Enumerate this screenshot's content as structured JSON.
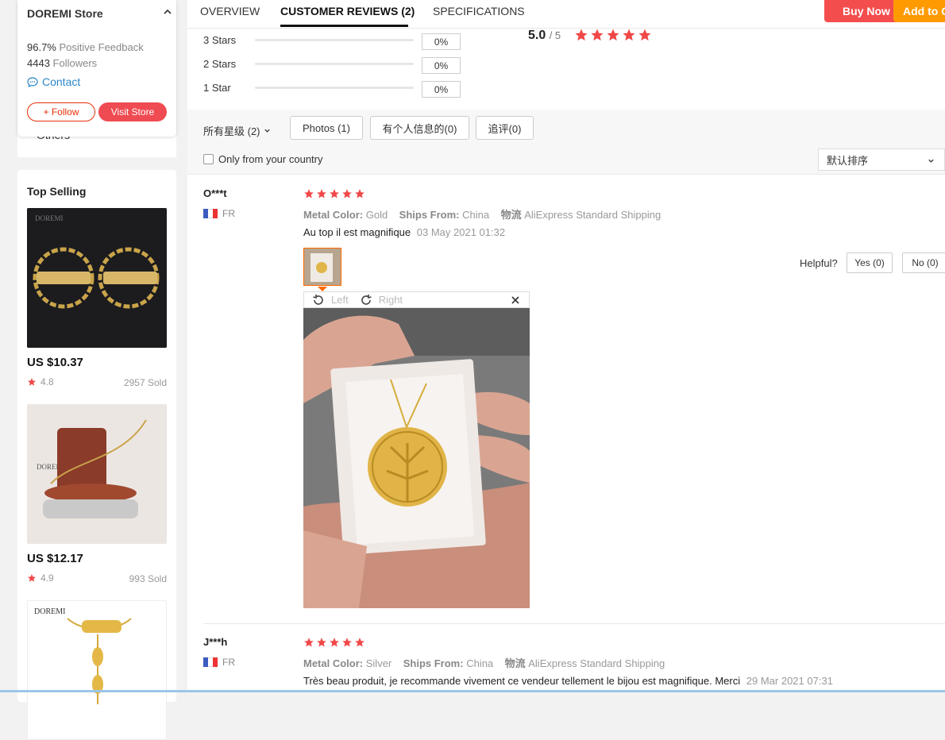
{
  "store": {
    "name": "DOREMI Store",
    "positive_value": "96.7%",
    "positive_label": "Positive Feedback",
    "followers_value": "4443",
    "followers_label": "Followers",
    "contact": "Contact",
    "follow": "+ Follow",
    "visit": "Visit Store",
    "others": "Others"
  },
  "top_selling": {
    "title": "Top Selling",
    "items": [
      {
        "price": "US $10.37",
        "rating": "4.8",
        "sold": "2957 Sold",
        "img_label": "DOREMI"
      },
      {
        "price": "US $12.17",
        "rating": "4.9",
        "sold": "993 Sold",
        "img_label": "DOREMI"
      },
      {
        "img_label": "DOREMI"
      }
    ]
  },
  "tabs": [
    {
      "label": "OVERVIEW"
    },
    {
      "label": "CUSTOMER REVIEWS (2)"
    },
    {
      "label": "SPECIFICATIONS"
    }
  ],
  "actions": {
    "buy_now": "Buy Now",
    "add_to_cart": "Add to C"
  },
  "rating_breakdown": [
    {
      "label": "3 Stars",
      "pct": "0%"
    },
    {
      "label": "2 Stars",
      "pct": "0%"
    },
    {
      "label": "1 Star",
      "pct": "0%"
    }
  ],
  "overall": {
    "score": "5.0",
    "out_of": "/ 5",
    "stars": 5
  },
  "filters": {
    "all_ratings": "所有星级 (2)",
    "photos": "Photos (1)",
    "personal_info": "有个人信息的(0)",
    "additional": "追评(0)",
    "only_country": "Only from your country",
    "sort": "默认排序"
  },
  "reviews": [
    {
      "user": "O***t",
      "country": "FR",
      "stars": 5,
      "color_label": "Metal Color:",
      "color": "Gold",
      "ships_label": "Ships From:",
      "ships": "China",
      "logistics_label": "物流",
      "logistics": "AliExpress Standard Shipping",
      "text": "Au top il est magnifique",
      "date": "03 May 2021 01:32",
      "helpful": "Helpful?",
      "yes": "Yes (0)",
      "no": "No (0)",
      "viewer_left": "Left",
      "viewer_right": "Right"
    },
    {
      "user": "J***h",
      "country": "FR",
      "stars": 5,
      "color_label": "Metal Color:",
      "color": "Silver",
      "ships_label": "Ships From:",
      "ships": "China",
      "logistics_label": "物流",
      "logistics": "AliExpress Standard Shipping",
      "text": "Très beau produit, je recommande vivement ce vendeur tellement le bijou est magnifique. Merci",
      "date": "29 Mar 2021 07:31"
    }
  ],
  "colors": {
    "accent_red": "#ef4b52",
    "star": "#f04848",
    "buy_now": "#f44d4d",
    "add_cart": "#ff9a00",
    "link_blue": "#2a86c8"
  },
  "icons": [
    "chevron-up-icon",
    "chat-icon",
    "star-icon",
    "chevron-down-icon",
    "rotate-left-icon",
    "rotate-right-icon",
    "close-icon",
    "flag-fr-icon"
  ]
}
